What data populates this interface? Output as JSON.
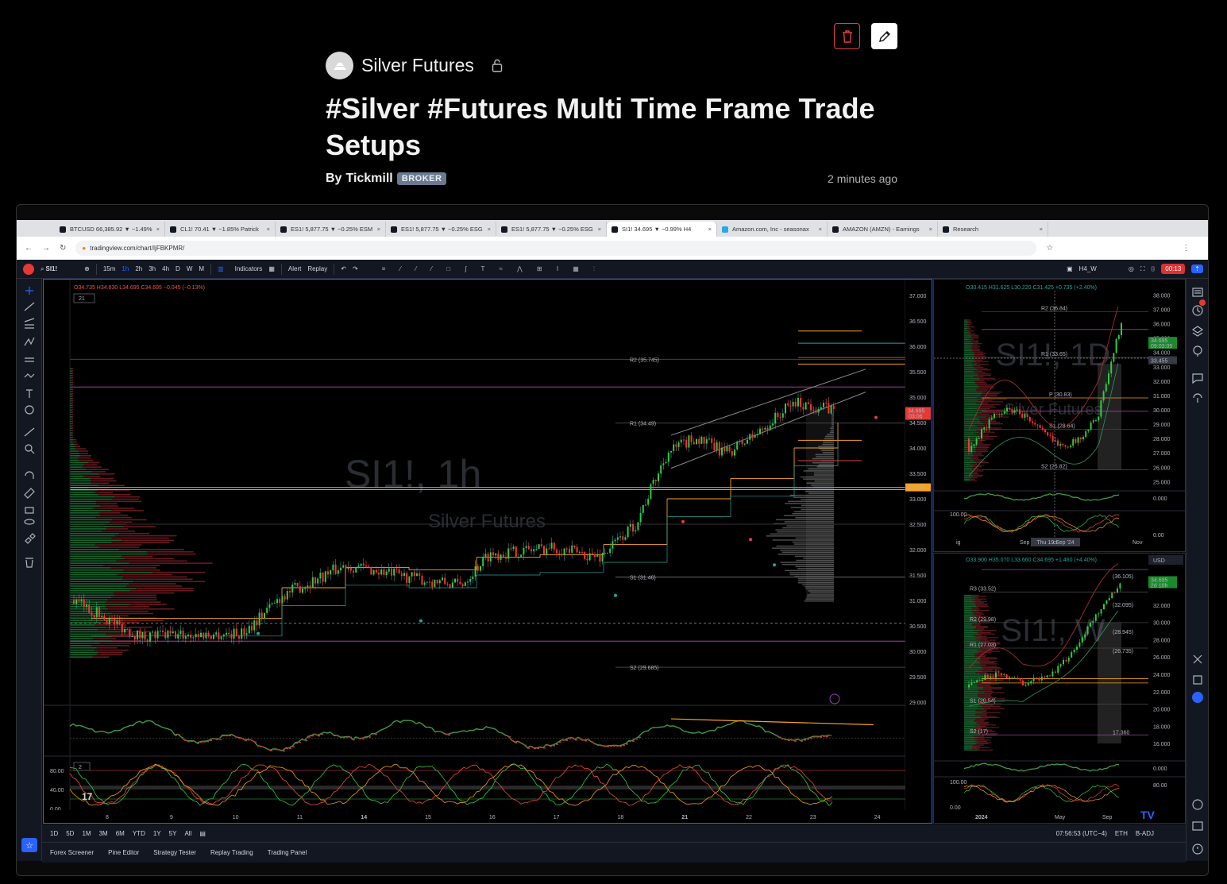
{
  "header": {
    "symbol_name": "Silver Futures",
    "title": "#Silver #Futures Multi Time Frame Trade Setups",
    "author_prefix": "By",
    "author": "Tickmill",
    "badge": "BROKER",
    "time_ago": "2 minutes ago"
  },
  "browser": {
    "tabs": [
      {
        "label": "BTCUSD 66,385.92 ▼ −1.49%",
        "active": false
      },
      {
        "label": "CL1! 70.41 ▼ −1.85% Patrick",
        "active": false
      },
      {
        "label": "ES1! 5,877.75 ▼ −0.25% ESM",
        "active": false
      },
      {
        "label": "ES1! 5,877.75 ▼ −0.25% ESG",
        "active": false
      },
      {
        "label": "ES1! 5,877.75 ▼ −0.25% ESG",
        "active": false
      },
      {
        "label": "SI1! 34.695 ▼ −0.99% H4",
        "active": true
      },
      {
        "label": "Amazon.com, Inc - seasonax",
        "active": false
      },
      {
        "label": "AMAZON (AMZN) - Earnings",
        "active": false
      },
      {
        "label": "Research",
        "active": false
      }
    ],
    "url": "tradingview.com/chart/IjFBKPMR/"
  },
  "toolbar": {
    "symbol": "SI1!",
    "intervals": [
      "15m",
      "1h",
      "2h",
      "3h",
      "4h",
      "D",
      "W",
      "M"
    ],
    "indicators": "Indicators",
    "alert": "Alert",
    "replay": "Replay",
    "layout_name": "H4_W",
    "layout_sub": "Save",
    "record_time": "00:13"
  },
  "main_chart": {
    "ohlc": "O34.735 H34.830 L34.695 C34.695 −0.045 (−0.13%)",
    "collapse": "21",
    "watermark_symbol": "SI1!, 1h",
    "watermark_name": "Silver Futures",
    "price_ticks": [
      "37.000",
      "36.500",
      "36.000",
      "35.500",
      "35.000",
      "34.500",
      "34.000",
      "33.500",
      "33.000",
      "32.500",
      "32.000",
      "31.500",
      "31.000",
      "30.500",
      "30.000",
      "29.500",
      "29.000"
    ],
    "last_price": "34.695",
    "last_countdown": "03:06",
    "level_tag": "33.225",
    "pivots": [
      "R2 (35.745)",
      "R1 (34.49)",
      "S1 (31.46)",
      "S2 (29.685)"
    ],
    "osc1_ticks": [
      "100.000",
      "50.000",
      "0.000",
      "−50.000"
    ],
    "osc2_label": "2",
    "osc2_ticks": [
      "80.00",
      "40.00",
      "0.00"
    ],
    "osc2_ticks_right": [
      "80.00",
      "40.00",
      "0.00"
    ],
    "time_ticks": [
      "8",
      "9",
      "10",
      "11",
      "14",
      "15",
      "16",
      "17",
      "18",
      "21",
      "22",
      "23",
      "24"
    ]
  },
  "daily_chart": {
    "ohlc": "O30.415 H31.625 L30.220 C31.425 +0.735 (+2.40%)",
    "watermark": "SI1!, 1D",
    "watermark_name": "Silver Futures",
    "price_ticks": [
      "38.000",
      "37.000",
      "36.000",
      "35.000",
      "34.000",
      "33.000",
      "32.000",
      "31.000",
      "30.000",
      "29.000",
      "28.000",
      "27.000",
      "26.000",
      "25.000"
    ],
    "last_price": "34.695",
    "countdown": "09:03:05",
    "crosshair_price": "33.455",
    "pivots": [
      "R2 (36.84)",
      "R1 (33.65)",
      "P (30.83)",
      "S1 (28.64)",
      "S2 (25.82)"
    ],
    "osc_ticks": [
      "0.000"
    ],
    "stoch_ticks": [
      "100.00",
      "0.00"
    ],
    "time_ticks": [
      "ig",
      "Sep",
      "ct",
      "Nov"
    ],
    "crosshair_date": "Thu 19 Sep '24"
  },
  "weekly_chart": {
    "ohlc": "O33.900 H35.070 L33.660 C34.695 +1.460 (+4.40%)",
    "currency": "USD",
    "scale": "apoz",
    "watermark": "SI1!, W",
    "price_ticks": [
      "32.000",
      "30.000",
      "28.000",
      "26.000",
      "24.000",
      "22.000",
      "20.000",
      "18.000",
      "16.000"
    ],
    "last_price": "34.695",
    "countdown": "2d 10h",
    "pivots": [
      "R3 (33.52)",
      "R2 (29.98)",
      "R1 (27.03)",
      "S1 (20.54)",
      "S2 (17)"
    ],
    "level_labels": [
      "(36.105)",
      "(32.095)",
      "(28.945)",
      "(26.735)",
      "17.360"
    ],
    "osc_ticks": [
      "0.000"
    ],
    "stoch_ticks": [
      "100.00",
      "80.00",
      "0.00"
    ],
    "time_ticks": [
      "2024",
      "May",
      "Sep"
    ]
  },
  "bottom": {
    "ranges": [
      "1D",
      "5D",
      "1M",
      "3M",
      "6M",
      "YTD",
      "1Y",
      "5Y",
      "All"
    ],
    "clock": "07:56:53 (UTC−4)",
    "session": "ETH",
    "adj": "B-ADJ",
    "panels": [
      "Forex Screener",
      "Pine Editor",
      "Strategy Tester",
      "Replay Trading",
      "Trading Panel"
    ]
  },
  "colors": {
    "up": "#26a69a",
    "down": "#ef5350",
    "accent_blue": "#2962ff",
    "pivot_orange": "#f7a21b",
    "delete_red": "#e04040"
  }
}
